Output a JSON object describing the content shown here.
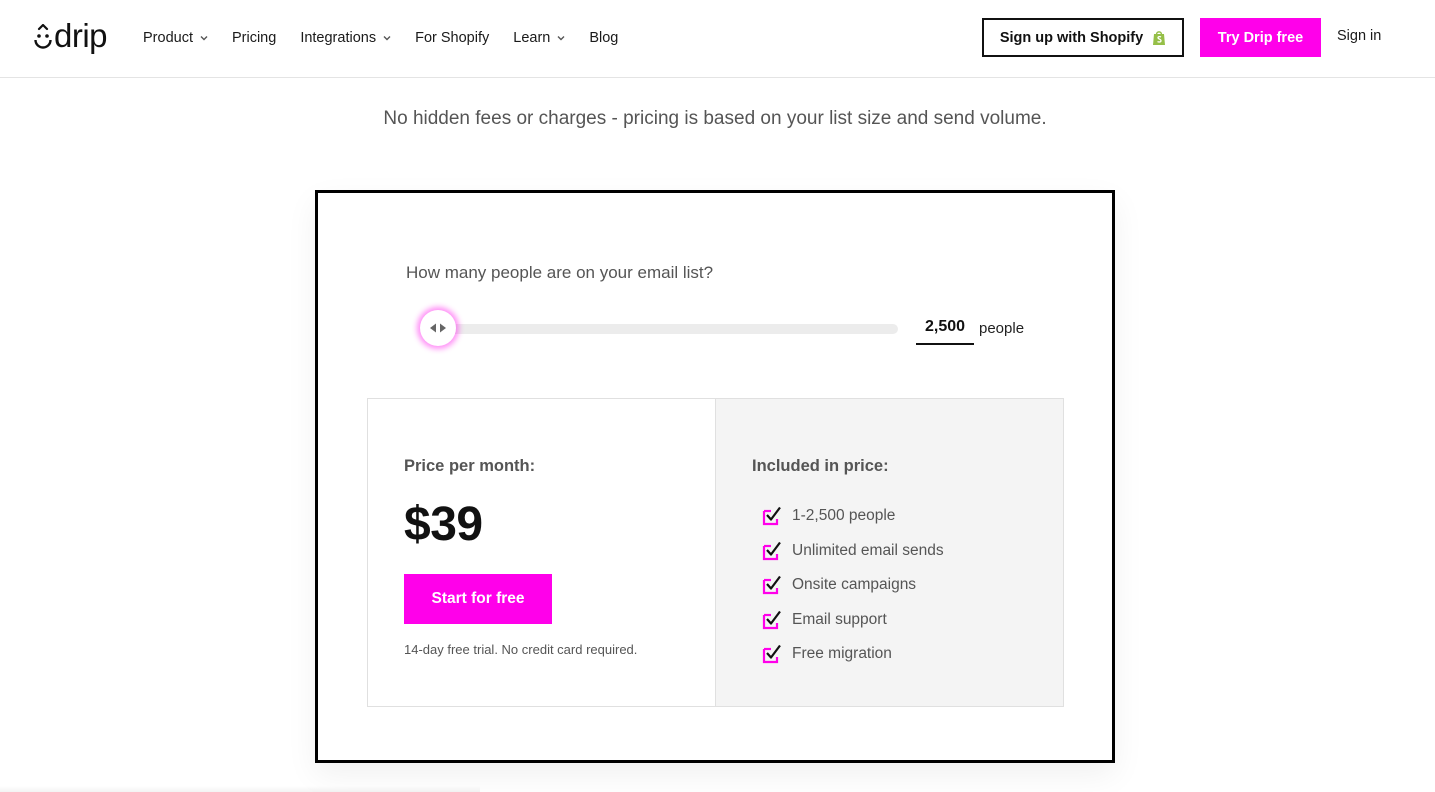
{
  "header": {
    "logo_text": "drip",
    "nav": [
      {
        "label": "Product",
        "has_dropdown": true
      },
      {
        "label": "Pricing",
        "has_dropdown": false
      },
      {
        "label": "Integrations",
        "has_dropdown": true
      },
      {
        "label": "For Shopify",
        "has_dropdown": false
      },
      {
        "label": "Learn",
        "has_dropdown": true
      },
      {
        "label": "Blog",
        "has_dropdown": false
      }
    ],
    "shopify_button": "Sign up with Shopify",
    "try_button": "Try Drip free",
    "sign_in": "Sign in"
  },
  "subtitle": "No hidden fees or charges - pricing is based on your list size and send volume.",
  "calculator": {
    "question": "How many people are on your email list?",
    "slider_position_fraction": 0.0,
    "count_value": "2,500",
    "count_unit": "people"
  },
  "pricing": {
    "price_label": "Price per month:",
    "price": "$39",
    "start_button": "Start for free",
    "trial_note": "14-day free trial. No credit card required.",
    "included_label": "Included in price:",
    "features": [
      "1-2,500 people",
      "Unlimited email sends",
      "Onsite campaigns",
      "Email support",
      "Free migration"
    ]
  },
  "colors": {
    "accent": "#ff00ea",
    "text": "#1a1a1a",
    "muted": "#555555",
    "panel": "#f4f4f4",
    "shopify_green": "#95bf47"
  }
}
